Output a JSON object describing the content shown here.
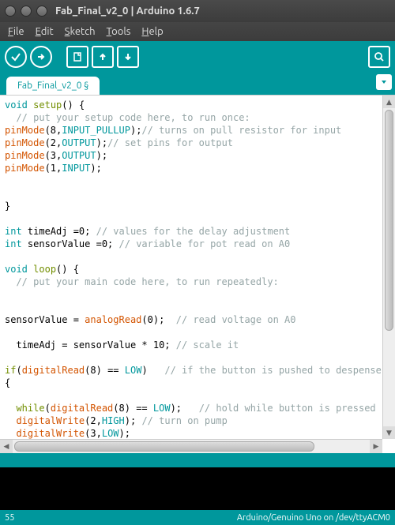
{
  "window": {
    "title": "Fab_Final_v2_0 | Arduino 1.6.7"
  },
  "menu": {
    "file": "File",
    "edit": "Edit",
    "sketch": "Sketch",
    "tools": "Tools",
    "help": "Help"
  },
  "tab": {
    "name": "Fab_Final_v2_0 §"
  },
  "code": {
    "l1a": "void",
    "l1b": " ",
    "l1c": "setup",
    "l1d": "() {",
    "l2a": "  // put your setup code here, to run once:",
    "l3a": "pinMode",
    "l3b": "(8,",
    "l3c": "INPUT_PULLUP",
    "l3d": ");",
    "l3e": "// turns on pull resistor for input",
    "l4a": "pinMode",
    "l4b": "(2,",
    "l4c": "OUTPUT",
    "l4d": ");",
    "l4e": "// set pins for output",
    "l5a": "pinMode",
    "l5b": "(3,",
    "l5c": "OUTPUT",
    "l5d": ");",
    "l6a": "pinMode",
    "l6b": "(1,",
    "l6c": "INPUT",
    "l6d": ");",
    "l7": "",
    "l8": "",
    "l9": "}",
    "l10": "",
    "l11a": "int",
    "l11b": " timeAdj =0; ",
    "l11c": "// values for the delay adjustment",
    "l12a": "int",
    "l12b": " sensorValue =0; ",
    "l12c": "// variable for pot read on A0",
    "l13": "",
    "l14a": "void",
    "l14b": " ",
    "l14c": "loop",
    "l14d": "() {",
    "l15a": "  // put your main code here, to run repeatedly:",
    "l16": "",
    "l17": "",
    "l18a": "sensorValue = ",
    "l18b": "analogRead",
    "l18c": "(0);  ",
    "l18d": "// read voltage on A0",
    "l19": "",
    "l20a": "  timeAdj = sensorValue * 10; ",
    "l20b": "// scale it",
    "l21": "",
    "l22a": "if",
    "l22b": "(",
    "l22c": "digitalRead",
    "l22d": "(8) == ",
    "l22e": "LOW",
    "l22f": ")   ",
    "l22g": "// if the button is pushed to despense",
    "l23": "{",
    "l24": "",
    "l25a": "  ",
    "l25b": "while",
    "l25c": "(",
    "l25d": "digitalRead",
    "l25e": "(8) == ",
    "l25f": "LOW",
    "l25g": ");   ",
    "l25h": "// hold while button is pressed",
    "l26a": "  ",
    "l26b": "digitalWrite",
    "l26c": "(2,",
    "l26d": "HIGH",
    "l26e": "); ",
    "l26f": "// turn on pump",
    "l27a": "  ",
    "l27b": "digitalWrite",
    "l27c": "(3,",
    "l27d": "LOW",
    "l27e": ");"
  },
  "status": {
    "line": "55",
    "board": "Arduino/Genuino Uno on /dev/ttyACM0"
  }
}
